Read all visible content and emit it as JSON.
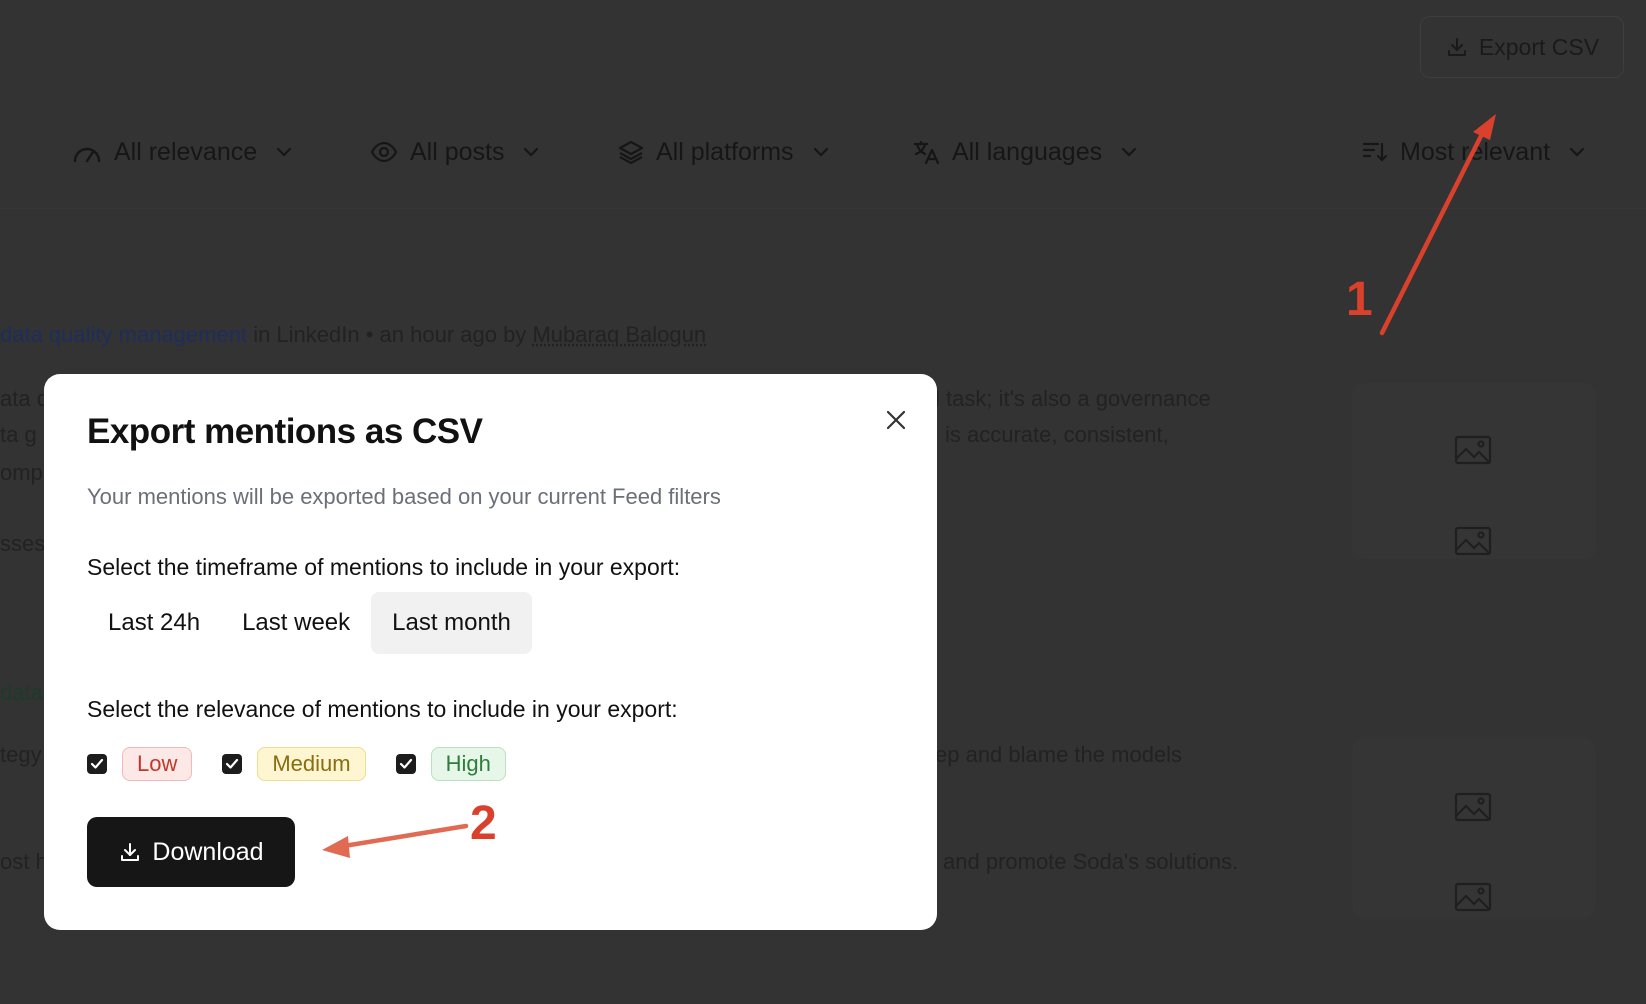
{
  "header": {
    "export_label": "Export CSV"
  },
  "filters": [
    {
      "label": "All relevance",
      "icon": "gauge-icon"
    },
    {
      "label": "All posts",
      "icon": "eye-icon"
    },
    {
      "label": "All platforms",
      "icon": "layers-icon"
    },
    {
      "label": "All languages",
      "icon": "translate-icon"
    }
  ],
  "sort": {
    "label": "Most relevant",
    "icon": "sort-icon"
  },
  "feed": {
    "item1": {
      "topic": "data quality management",
      "platform_text": "in LinkedIn • an hour ago by",
      "author": "Mubaraq Balogun",
      "fragments": [
        "ata q",
        "ta g",
        "omp",
        "sses",
        "l task; it's also a governance",
        "is accurate, consistent,"
      ]
    },
    "item2": {
      "topic_fragment": "data",
      "fragments": [
        "tegy",
        "ost h",
        "ep and blame the models",
        "and promote Soda's solutions."
      ]
    }
  },
  "modal": {
    "title": "Export mentions as CSV",
    "subtitle": "Your mentions will be exported based on your current Feed filters",
    "timeframe_label": "Select the timeframe of mentions to include in your export:",
    "timeframes": [
      "Last 24h",
      "Last week",
      "Last month"
    ],
    "selected_timeframe": "Last month",
    "relevance_label": "Select the relevance of mentions to include in your export:",
    "relevance": [
      {
        "label": "Low",
        "checked": true
      },
      {
        "label": "Medium",
        "checked": true
      },
      {
        "label": "High",
        "checked": true
      }
    ],
    "download_label": "Download"
  },
  "annotations": {
    "step1": "1",
    "step2": "2",
    "color": "#d9412c"
  }
}
